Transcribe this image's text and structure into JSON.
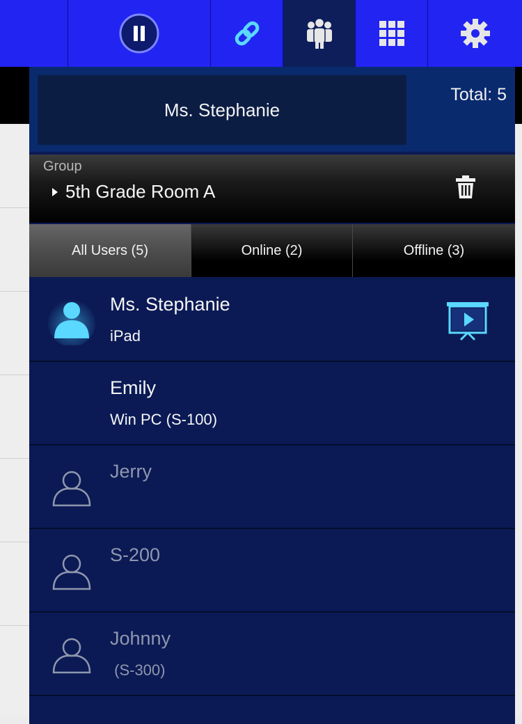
{
  "toolbar": {
    "buttons": [
      {
        "name": "pause",
        "icon": "pause-icon"
      },
      {
        "name": "link",
        "icon": "link-icon"
      },
      {
        "name": "users",
        "icon": "users-icon",
        "active": true
      },
      {
        "name": "grid",
        "icon": "grid-icon"
      },
      {
        "name": "settings",
        "icon": "gear-icon"
      }
    ]
  },
  "header": {
    "self_name": "Ms. Stephanie",
    "total": "Total: 5"
  },
  "group": {
    "caption": "Group",
    "name": "5th Grade Room A"
  },
  "tabs": [
    {
      "label": "All Users (5)",
      "active": true
    },
    {
      "label": "Online (2)",
      "active": false
    },
    {
      "label": "Offline (3)",
      "active": false
    }
  ],
  "users": [
    {
      "name": "Ms. Stephanie",
      "device": "iPad",
      "status": "online",
      "icon": "teacher-user-icon",
      "presenting": true
    },
    {
      "name": "Emily",
      "device": "Win PC (S-100)",
      "status": "online"
    },
    {
      "name": "Jerry",
      "device": "",
      "status": "offline",
      "icon": "user-outline-icon"
    },
    {
      "name": "S-200",
      "device": "",
      "status": "offline",
      "icon": "user-outline-icon"
    },
    {
      "name": "Johnny",
      "device": " (S-300)",
      "status": "offline",
      "icon": "user-outline-icon"
    }
  ],
  "colors": {
    "toolbar": "#1e1ff0",
    "panel": "#0b1a55",
    "accent_cyan": "#4fd4ff"
  }
}
